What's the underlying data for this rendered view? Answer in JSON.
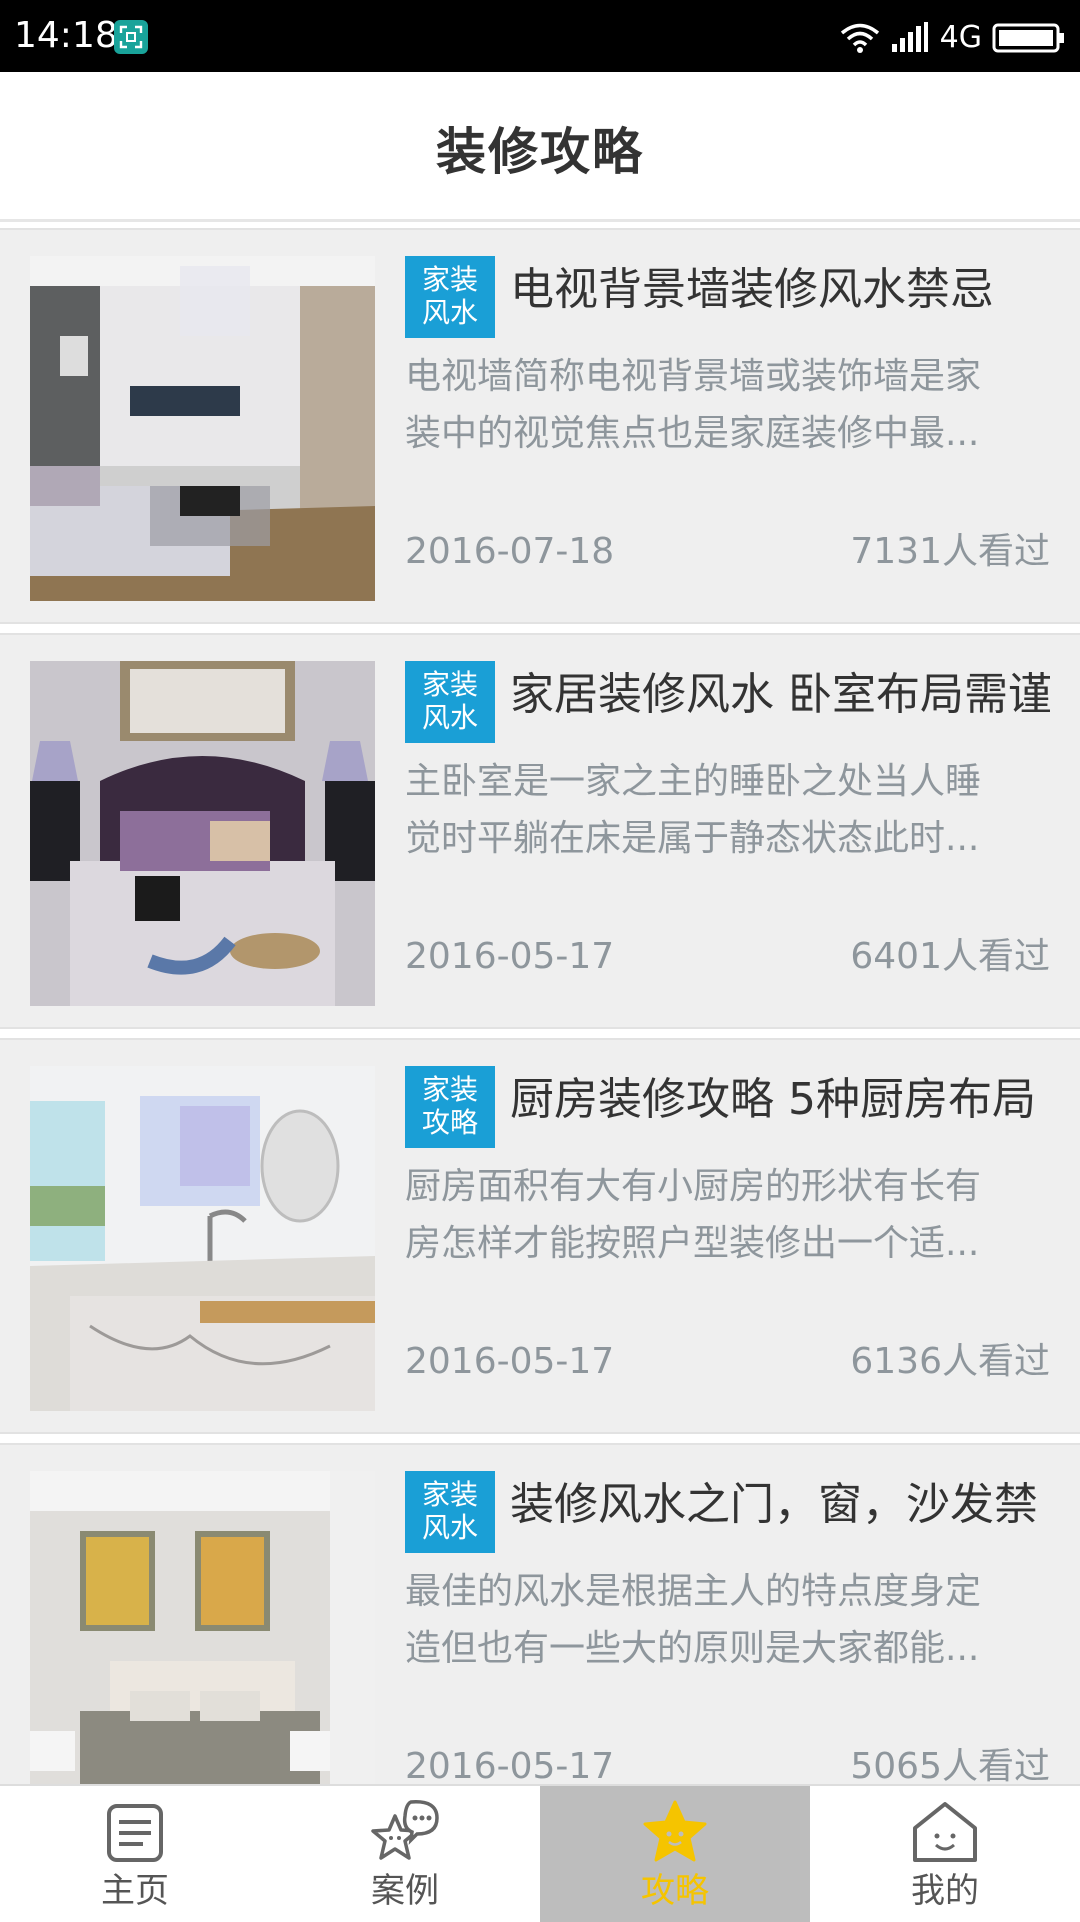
{
  "status_bar": {
    "time": "14:18",
    "network": "4G",
    "icons": [
      "screenshot-app-icon",
      "wifi-icon",
      "signal-icon",
      "battery-icon"
    ]
  },
  "header": {
    "title": "装修攻略"
  },
  "colors": {
    "tag_background": "#1a9fd6",
    "active_tab_background": "#bdbdbd",
    "active_tab_color": "#f5c400",
    "muted_text": "#8e969c",
    "title_text": "#333333"
  },
  "articles": [
    {
      "tag_line1": "家装",
      "tag_line2": "风水",
      "title": "电视背景墙装修风水禁忌",
      "summary_line1": "电视墙简称电视背景墙或装饰墙是家",
      "summary_line2": "装中的视觉焦点也是家庭装修中最...",
      "date": "2016-07-18",
      "views": "7131人看过",
      "image": "living-room-photo"
    },
    {
      "tag_line1": "家装",
      "tag_line2": "风水",
      "title": "家居装修风水 卧室布局需谨",
      "summary_line1": "主卧室是一家之主的睡卧之处当人睡",
      "summary_line2": "觉时平躺在床是属于静态状态此时...",
      "date": "2016-05-17",
      "views": "6401人看过",
      "image": "bedroom-photo"
    },
    {
      "tag_line1": "家装",
      "tag_line2": "攻略",
      "title": "厨房装修攻略 5种厨房布局",
      "summary_line1": "厨房面积有大有小厨房的形状有长有",
      "summary_line2": "房怎样才能按照户型装修出一个适...",
      "date": "2016-05-17",
      "views": "6136人看过",
      "image": "kitchen-photo"
    },
    {
      "tag_line1": "家装",
      "tag_line2": "风水",
      "title": "装修风水之门，窗，沙发禁",
      "summary_line1": "最佳的风水是根据主人的特点度身定",
      "summary_line2": "造但也有一些大的原则是大家都能...",
      "date": "2016-05-17",
      "views": "5065人看过",
      "image": "bedroom-paintings-photo"
    }
  ],
  "bottom_nav": [
    {
      "label": "主页",
      "icon": "home-list-icon",
      "active": false
    },
    {
      "label": "案例",
      "icon": "chat-star-icon",
      "active": false
    },
    {
      "label": "攻略",
      "icon": "star-icon",
      "active": true
    },
    {
      "label": "我的",
      "icon": "house-face-icon",
      "active": false
    }
  ]
}
